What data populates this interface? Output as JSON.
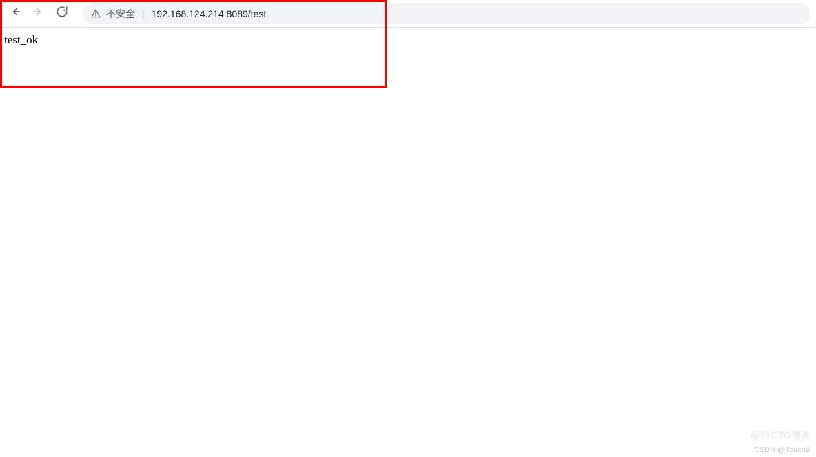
{
  "toolbar": {
    "security_label": "不安全",
    "url": "192.168.124.214:8089/test"
  },
  "page": {
    "body_text": "test_ok"
  },
  "watermarks": {
    "top": "@51CTO博客",
    "bottom": "CSDN @Touch&"
  }
}
